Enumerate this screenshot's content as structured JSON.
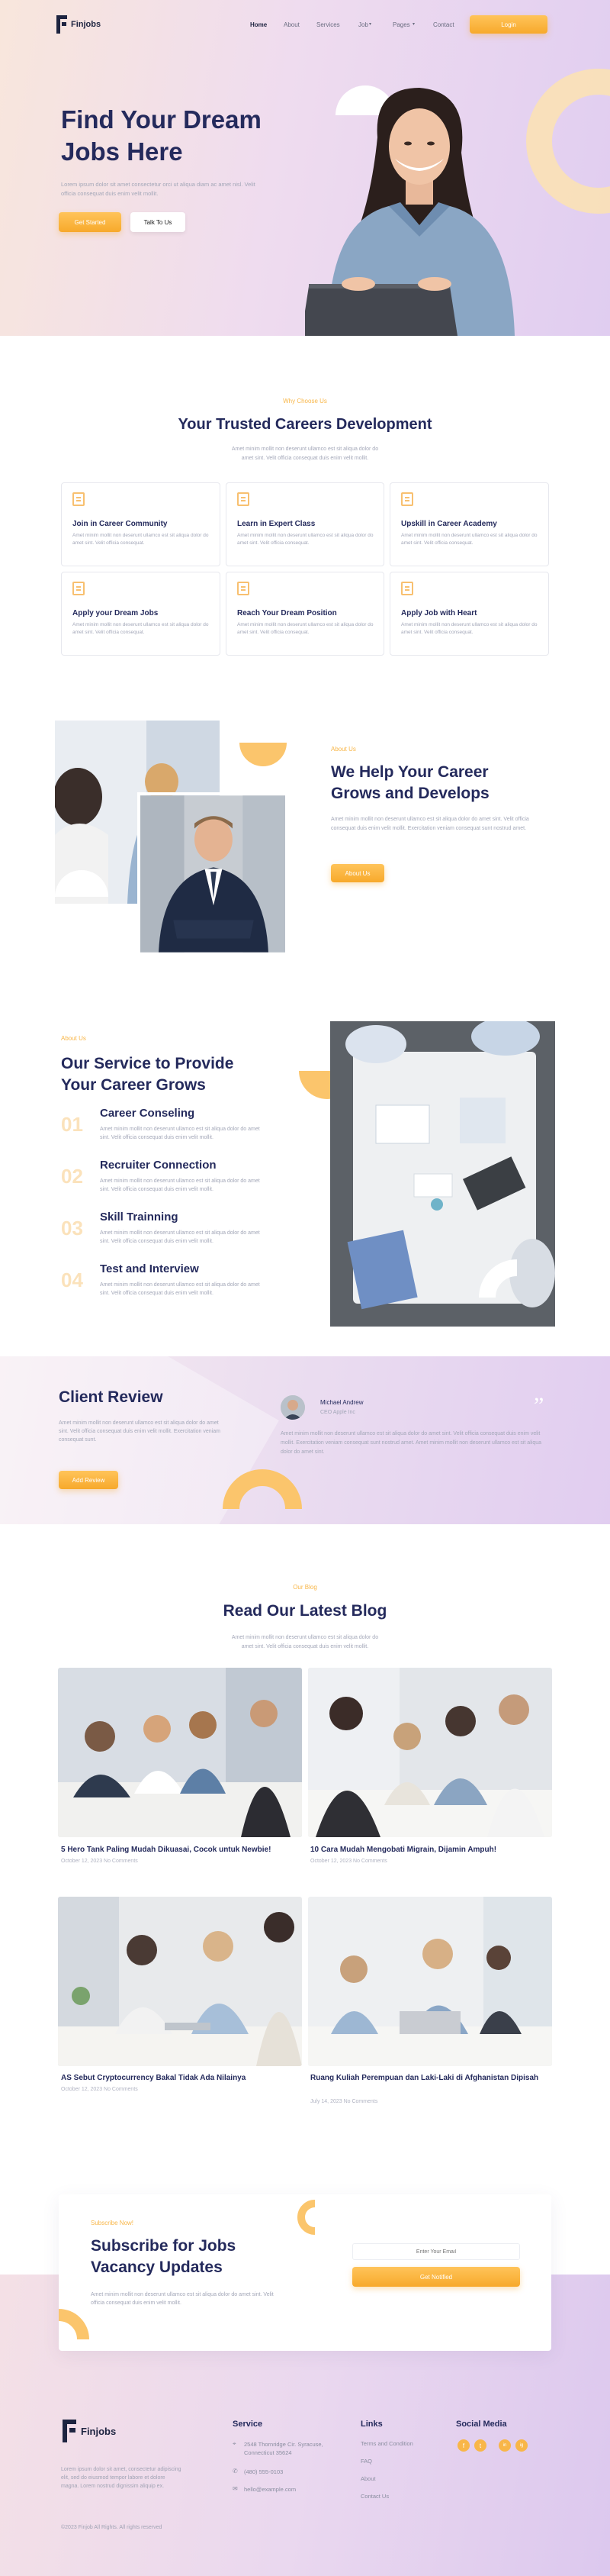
{
  "brand": {
    "name": "Finjobs",
    "accent": "#f8b648",
    "dark": "#242a5c"
  },
  "nav": {
    "items": [
      "Home",
      "About",
      "Services",
      "Job",
      "Pages",
      "Contact"
    ],
    "login": "Login"
  },
  "hero": {
    "title_line1": "Find Your Dream",
    "title_line2": "Jobs Here",
    "desc": "Lorem ipsum dolor sit amet consectetur orci ut aliqua diam ac amet nisl. Velit officia consequat duis enim velit mollit.",
    "btn_primary": "Get Started",
    "btn_secondary": "Talk To Us"
  },
  "why": {
    "eyebrow": "Why Choose Us",
    "title": "Your Trusted Careers Development",
    "desc_line1": "Amet minim mollit non deserunt ullamco est sit aliqua dolor do",
    "desc_line2": "amet sint. Velit officia consequat duis enim velit mollit.",
    "cards": [
      {
        "title": "Join in Career Community",
        "desc": "Amet minim mollit non deserunt ullamco est sit aliqua dolor do amet sint. Velit officia consequat."
      },
      {
        "title": "Learn in Expert Class",
        "desc": "Amet minim mollit non deserunt ullamco est sit aliqua dolor do amet sint. Velit officia consequat."
      },
      {
        "title": "Upskill in Career Academy",
        "desc": "Amet minim mollit non deserunt ullamco est sit aliqua dolor do amet sint. Velit officia consequat."
      },
      {
        "title": "Apply your Dream Jobs",
        "desc": "Amet minim mollit non deserunt ullamco est sit aliqua dolor do amet sint. Velit officia consequat."
      },
      {
        "title": "Reach Your Dream Position",
        "desc": "Amet minim mollit non deserunt ullamco est sit aliqua dolor do amet sint. Velit officia consequat."
      },
      {
        "title": "Apply Job with Heart",
        "desc": "Amet minim mollit non deserunt ullamco est sit aliqua dolor do amet sint. Velit officia consequat."
      }
    ]
  },
  "about": {
    "eyebrow": "About Us",
    "title_line1": "We Help Your Career",
    "title_line2": "Grows and Develops",
    "desc": "Amet minim mollit non deserunt ullamco est sit aliqua dolor do amet sint. Velit officia consequat duis enim velit mollit. Exercitation veniam consequat sunt nostrud amet.",
    "btn": "About Us"
  },
  "service": {
    "eyebrow": "About Us",
    "title_line1": "Our Service to Provide",
    "title_line2": "Your Career Grows",
    "items": [
      {
        "num": "01",
        "title": "Career Conseling",
        "desc": "Amet minim mollit non deserunt ullamco est sit aliqua dolor do amet sint. Velit officia consequat duis enim velit mollit."
      },
      {
        "num": "02",
        "title": "Recruiter Connection",
        "desc": "Amet minim mollit non deserunt ullamco est sit aliqua dolor do amet sint. Velit officia consequat duis enim velit mollit."
      },
      {
        "num": "03",
        "title": "Skill Trainning",
        "desc": "Amet minim mollit non deserunt ullamco est sit aliqua dolor do amet sint. Velit officia consequat duis enim velit mollit."
      },
      {
        "num": "04",
        "title": "Test and Interview",
        "desc": "Amet minim mollit non deserunt ullamco est sit aliqua dolor do amet sint. Velit officia consequat duis enim velit mollit."
      }
    ]
  },
  "review": {
    "title": "Client Review",
    "desc": "Amet minim mollit non deserunt ullamco est sit aliqua dolor do amet sint. Velit officia consequat duis enim velit mollit. Exercitation veniam consequat sunt.",
    "btn": "Add Review",
    "name": "Michael Andrew",
    "role": "CEO Apple Inc",
    "quote": "Amet minim mollit non deserunt ullamco est sit aliqua dolor do amet sint. Velit officia consequat duis enim velit mollit. Exercitation veniam consequat sunt nostrud amet. Amet minim mollit non deserunt ullamco est sit aliqua dolor do amet sint."
  },
  "blog": {
    "eyebrow": "Our Blog",
    "title": "Read Our Latest Blog",
    "desc_line1": "Amet minim mollit non deserunt ullamco est sit aliqua dolor do",
    "desc_line2": "amet sint. Velit officia consequat duis enim velit mollit.",
    "posts": [
      {
        "title": "5 Hero Tank Paling Mudah Dikuasai, Cocok untuk Newbie!",
        "meta": "October 12, 2023  No Comments"
      },
      {
        "title": "10 Cara Mudah Mengobati Migrain, Dijamin Ampuh!",
        "meta": "October 12, 2023  No Comments"
      },
      {
        "title": "AS Sebut Cryptocurrency Bakal Tidak Ada Nilainya",
        "meta": "October 12, 2023  No Comments"
      },
      {
        "title": "Ruang Kuliah Perempuan dan Laki-Laki di Afghanistan Dipisah",
        "meta": "July 14, 2023  No Comments"
      }
    ]
  },
  "subscribe": {
    "eyebrow": "Subscribe Now!",
    "title_line1": "Subscribe for Jobs",
    "title_line2": "Vacancy Updates",
    "desc": "Amet minim mollit non deserunt ullamco est sit aliqua dolor do amet sint. Velit officia consequat duis enim velit mollit.",
    "placeholder": "Enter Your Email",
    "btn": "Get Notified"
  },
  "footer": {
    "about": "Lorem ipsum dolor sit amet, consectetur adipiscing elit, sed do eiusmod tempor labore et dolore magna. Lorem nostrud dignissim aliquip ex.",
    "copyright": "©2023 Finjob All Rights. All rights reserved",
    "service_title": "Service",
    "address": "2548 Thornridge Cir. Syracuse, Connecticut 35624",
    "phone": "(480) 555-0103",
    "email": "hello@example.com",
    "links_title": "Links",
    "links": [
      "Terms and Condition",
      "FAQ",
      "About",
      "Contact Us"
    ],
    "social_title": "Social Media",
    "social": [
      "f",
      "t",
      "in",
      "ig"
    ]
  }
}
